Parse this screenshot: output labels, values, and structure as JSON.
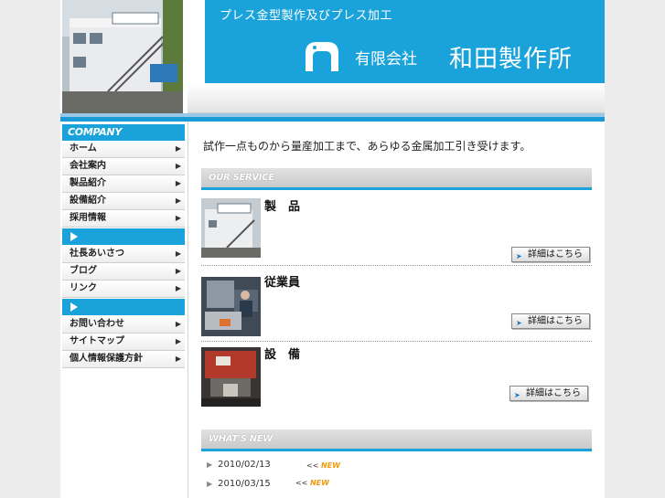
{
  "header": {
    "tagline": "プレス金型製作及びプレス加工",
    "company_prefix": "有限会社",
    "company_name": "和田製作所"
  },
  "sidebar": {
    "company_label": "COMPANY",
    "group1": [
      {
        "label": "ホーム"
      },
      {
        "label": "会社案内"
      },
      {
        "label": "製品紹介"
      },
      {
        "label": "設備紹介"
      },
      {
        "label": "採用情報"
      }
    ],
    "group2": [
      {
        "label": "社長あいさつ"
      },
      {
        "label": "ブログ"
      },
      {
        "label": "リンク"
      }
    ],
    "group3": [
      {
        "label": "お問い合わせ"
      },
      {
        "label": "サイトマップ"
      },
      {
        "label": "個人情報保護方針"
      }
    ]
  },
  "main": {
    "intro": "試作一点ものから量産加工まで、あらゆる金属加工引き受けます。",
    "service_heading": "OUR SERVICE",
    "services": [
      {
        "title": "製　品",
        "button": "詳細はこちら"
      },
      {
        "title": "従業員",
        "button": "詳細はこちら"
      },
      {
        "title": "設　備",
        "button": "詳細はこちら"
      }
    ],
    "news_heading": "WHAT'S NEW",
    "news": [
      {
        "date": "2010/02/13",
        "mark": "<<",
        "badge": "NEW"
      },
      {
        "date": "2010/03/15",
        "mark": "<<",
        "badge": "NEW"
      }
    ]
  },
  "colors": {
    "accent": "#1aa3da",
    "badge": "#f29a0f"
  }
}
